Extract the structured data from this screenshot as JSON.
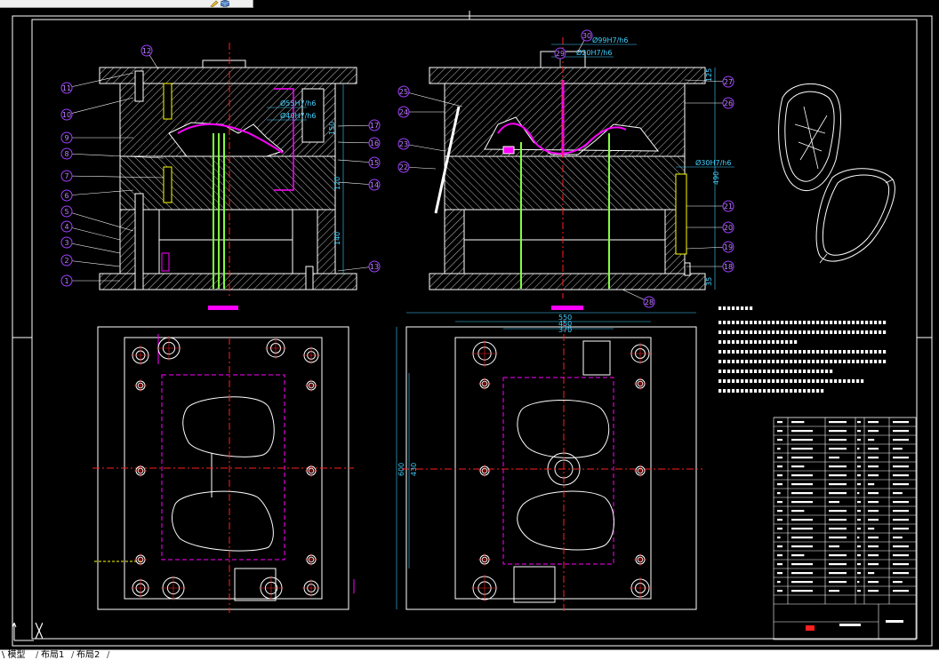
{
  "toolbar": {
    "icons": [
      "pencil-icon",
      "cube-icon"
    ]
  },
  "drawing": {
    "dimensions": {
      "d1": "Ø55H7/h6",
      "d2": "Ø40H7/h6",
      "d3": "Ø99H7/h6",
      "d4": "Ø20H7/h6",
      "d5": "Ø30H7/h6",
      "d6": "550",
      "d7": "450",
      "d8": "370",
      "d9": "600",
      "d10": "430",
      "d11": "490",
      "d12": "140",
      "d13": "120",
      "d14": "150",
      "d15": "35",
      "d16": "125"
    },
    "left_balloons": [
      "1",
      "2",
      "3",
      "4",
      "5",
      "6",
      "7",
      "8",
      "9",
      "10",
      "11",
      "12",
      "13",
      "14",
      "15",
      "16",
      "17"
    ],
    "right_balloons": [
      "18",
      "19",
      "20",
      "21",
      "22",
      "23",
      "24",
      "25",
      "26",
      "27",
      "28",
      "29",
      "30"
    ],
    "colors": {
      "background": "#000000",
      "line": "#ffffff",
      "hatch": "#d8d8d8",
      "center": "#ff2020",
      "magenta": "#ff00ff",
      "pin": "#80ff40",
      "cyan": "#00c0ff",
      "balloon": "#a040ff",
      "dimension": "#40d0ff",
      "yellow": "#ffff00"
    }
  },
  "layout_tabs": {
    "model": "\\ 模型",
    "layout1": "布局1",
    "layout2": "布局2"
  }
}
